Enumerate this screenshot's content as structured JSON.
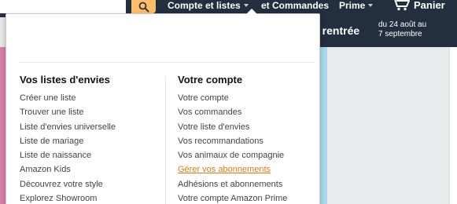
{
  "nav": {
    "account_label": "Compte et listes",
    "orders_label": "et Commandes",
    "prime_label": "Prime",
    "cart_label": "Panier"
  },
  "banner": {
    "headline": "e rentrée",
    "dates_line1": "du 24 août au",
    "dates_line2": "7 septembre"
  },
  "lists": {
    "title": "Vos listes d'envies",
    "items": [
      "Créer une liste",
      "Trouver une liste",
      "Liste d'envies universelle",
      "Liste de mariage",
      "Liste de naissance",
      "Amazon Kids",
      "Découvrez votre style",
      "Explorez Showroom"
    ]
  },
  "account": {
    "title": "Votre compte",
    "items": [
      "Votre compte",
      "Vos commandes",
      "Votre liste d'envies",
      "Vos recommandations",
      "Vos animaux de compagnie",
      "Gérer vos abonnements",
      "Adhésions et abonnements",
      "Votre compte Amazon Prime"
    ],
    "hovered_index": 5
  },
  "colors": {
    "nav_bg": "#232f3e",
    "search_btn": "#febd69",
    "link_hover": "#e47911"
  },
  "icons": {
    "search": "search-icon",
    "cart": "cart-icon",
    "caret": "caret-down-icon"
  }
}
